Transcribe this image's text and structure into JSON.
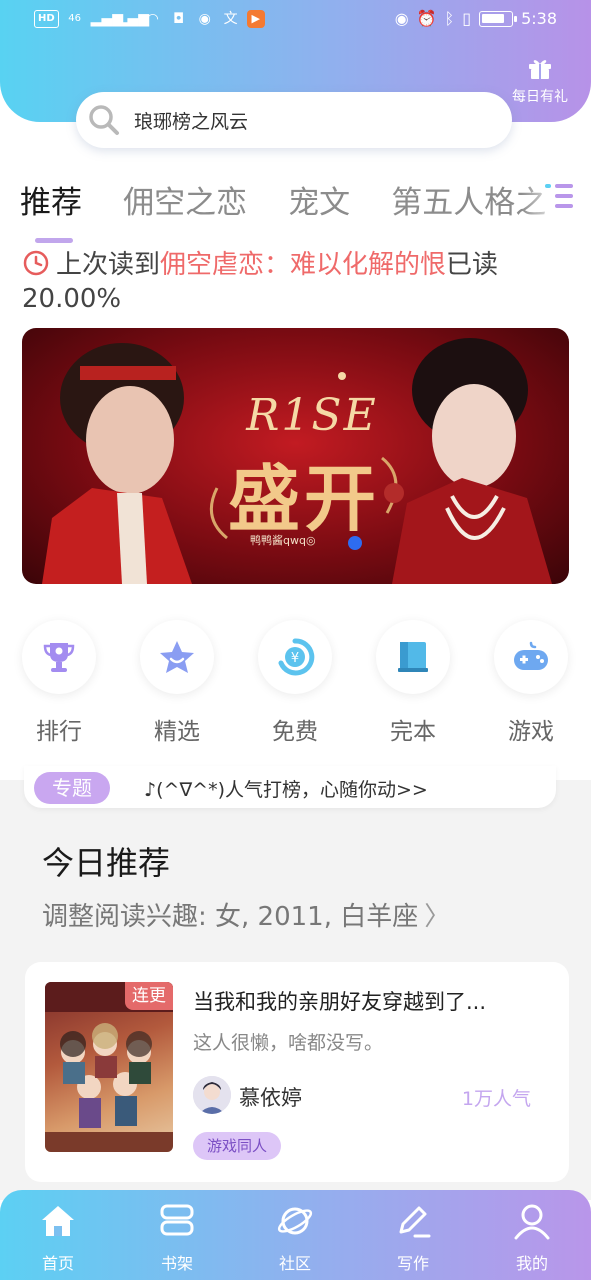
{
  "status_bar": {
    "left_chips": [
      "HD",
      "46"
    ],
    "time": "5:38",
    "battery_level": 0.8
  },
  "header": {
    "search_text": "琅琊榜之风云",
    "gift_label": "每日有礼"
  },
  "tabs": {
    "items": [
      {
        "label": "推荐",
        "active": true
      },
      {
        "label": "佣空之恋",
        "active": false
      },
      {
        "label": "宠文",
        "active": false
      },
      {
        "label": "第五人格之",
        "active": false
      }
    ]
  },
  "last_read": {
    "prefix": "上次读到",
    "title": "佣空虐恋：难以化解的恨",
    "suffix": "已读",
    "progress": "20.00%"
  },
  "banner": {
    "title_en": "R1SE",
    "title_cn": "盛开",
    "credit": "鸭鸭酱qwq◎",
    "accent": "#c21b22"
  },
  "quick_links": [
    {
      "label": "排行",
      "icon": "trophy-icon",
      "color": "#a38cf0"
    },
    {
      "label": "精选",
      "icon": "star-icon",
      "color": "#8a9df2"
    },
    {
      "label": "免费",
      "icon": "yen-coin-icon",
      "color": "#5cc3ee"
    },
    {
      "label": "完本",
      "icon": "book-icon",
      "color": "#52b9e8"
    },
    {
      "label": "游戏",
      "icon": "gamepad-icon",
      "color": "#6ea8f0"
    }
  ],
  "topic": {
    "badge": "专题",
    "text": "♪(^∇^*)人气打榜，心随你动>>"
  },
  "today": {
    "title": "今日推荐",
    "subtitle": "调整阅读兴趣: 女, 2011, 白羊座",
    "chevron": "〉"
  },
  "book_card": {
    "tag": "连更",
    "title": "当我和我的亲朋好友穿越到了...",
    "description": "这人很懒，啥都没写。",
    "author": "慕依婷",
    "popularity": "1万人气",
    "genre": "游戏同人"
  },
  "bottom_nav": [
    {
      "label": "首页",
      "icon": "home-icon"
    },
    {
      "label": "书架",
      "icon": "bookshelf-icon"
    },
    {
      "label": "社区",
      "icon": "planet-icon"
    },
    {
      "label": "写作",
      "icon": "pen-icon"
    },
    {
      "label": "我的",
      "icon": "user-icon"
    }
  ],
  "colors": {
    "accent_purple": "#c1a6ec",
    "highlight_red": "#ef6a6a",
    "gradient_start": "#58d2f2",
    "gradient_end": "#b792e8"
  }
}
